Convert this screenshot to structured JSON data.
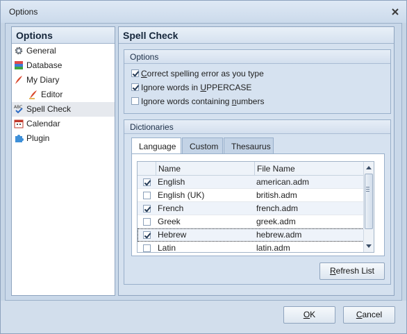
{
  "window": {
    "title": "Options"
  },
  "nav": {
    "header": "Options",
    "items": [
      {
        "label": "General",
        "icon": "gear-icon"
      },
      {
        "label": "Database",
        "icon": "database-icon"
      },
      {
        "label": "My Diary",
        "icon": "quill-icon"
      },
      {
        "label": "Editor",
        "icon": "quill-icon"
      },
      {
        "label": "Spell Check",
        "icon": "spell-check-icon",
        "selected": true
      },
      {
        "label": "Calendar",
        "icon": "calendar-icon"
      },
      {
        "label": "Plugin",
        "icon": "puzzle-icon"
      }
    ]
  },
  "content": {
    "header": "Spell Check",
    "options": {
      "header": "Options",
      "items": [
        {
          "pre": "",
          "ul": "C",
          "post": "orrect spelling error as you type",
          "checked": true
        },
        {
          "pre": "Ignore words in ",
          "ul": "U",
          "post": "PPERCASE",
          "checked": true
        },
        {
          "pre": "Ignore words containing ",
          "ul": "n",
          "post": "umbers",
          "checked": false
        }
      ]
    },
    "dictionaries": {
      "header": "Dictionaries",
      "tabs": [
        "Language",
        "Custom",
        "Thesaurus"
      ],
      "columns": [
        "Name",
        "File Name"
      ],
      "rows": [
        {
          "name": "English",
          "file": "american.adm",
          "checked": true
        },
        {
          "name": "English (UK)",
          "file": "british.adm",
          "checked": false
        },
        {
          "name": "French",
          "file": "french.adm",
          "checked": true
        },
        {
          "name": "Greek",
          "file": "greek.adm",
          "checked": false
        },
        {
          "name": "Hebrew",
          "file": "hebrew.adm",
          "checked": true
        },
        {
          "name": "Latin",
          "file": "latin.adm",
          "checked": false
        }
      ],
      "refresh_pre": "",
      "refresh_ul": "R",
      "refresh_post": "efresh List"
    }
  },
  "footer": {
    "ok_ul": "O",
    "ok_post": "K",
    "cancel_ul": "C",
    "cancel_post": "ancel"
  }
}
